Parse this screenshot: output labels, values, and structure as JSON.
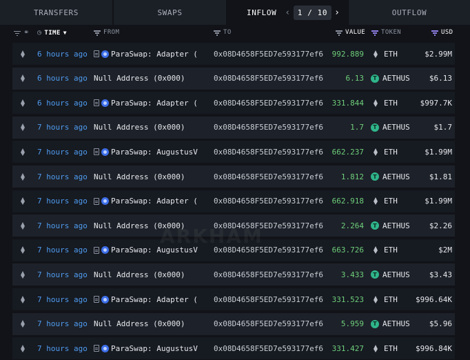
{
  "tabs": [
    {
      "label": "TRANSFERS"
    },
    {
      "label": "SWAPS"
    },
    {
      "label": "INFLOW",
      "active": true,
      "page": "1 / 10"
    },
    {
      "label": "OUTFLOW"
    }
  ],
  "columns": {
    "time": "TIME",
    "from": "FROM",
    "to": "TO",
    "value": "VALUE",
    "token": "TOKEN",
    "usd": "USD"
  },
  "watermark": "ARKHAM",
  "colors": {
    "link_blue": "#4f9cf0",
    "value_green": "#6fcf7b",
    "accent_purple": "#8f7fe6",
    "aethus_green": "#2fb58a"
  },
  "rows": [
    {
      "chain_icon": "ethereum-icon",
      "time": "6 hours ago",
      "from": "ParaSwap: Adapter (",
      "from_icons": true,
      "to": "0x08D4658F5ED7e593177ef6",
      "value": "992.889",
      "token": "ETH",
      "token_icon": "ethereum-icon",
      "usd": "$2.99M"
    },
    {
      "chain_icon": "ethereum-icon",
      "time": "6 hours ago",
      "from": "Null Address (0x000)",
      "from_icons": false,
      "to": "0x08D4658F5ED7e593177ef6",
      "value": "6.13",
      "token": "AETHUS",
      "token_icon": "aethus-icon",
      "usd": "$6.13"
    },
    {
      "chain_icon": "ethereum-icon",
      "time": "6 hours ago",
      "from": "ParaSwap: Adapter (",
      "from_icons": true,
      "to": "0x08D4658F5ED7e593177ef6",
      "value": "331.844",
      "token": "ETH",
      "token_icon": "ethereum-icon",
      "usd": "$997.7K"
    },
    {
      "chain_icon": "ethereum-icon",
      "time": "7 hours ago",
      "from": "Null Address (0x000)",
      "from_icons": false,
      "to": "0x08D4658F5ED7e593177ef6",
      "value": "1.7",
      "token": "AETHUS",
      "token_icon": "aethus-icon",
      "usd": "$1.7"
    },
    {
      "chain_icon": "ethereum-icon",
      "time": "7 hours ago",
      "from": "ParaSwap: AugustusV",
      "from_icons": true,
      "to": "0x08D4658F5ED7e593177ef6",
      "value": "662.237",
      "token": "ETH",
      "token_icon": "ethereum-icon",
      "usd": "$1.99M"
    },
    {
      "chain_icon": "ethereum-icon",
      "time": "7 hours ago",
      "from": "Null Address (0x000)",
      "from_icons": false,
      "to": "0x08D4658F5ED7e593177ef6",
      "value": "1.812",
      "token": "AETHUS",
      "token_icon": "aethus-icon",
      "usd": "$1.81"
    },
    {
      "chain_icon": "ethereum-icon",
      "time": "7 hours ago",
      "from": "ParaSwap: Adapter (",
      "from_icons": true,
      "to": "0x08D4658F5ED7e593177ef6",
      "value": "662.918",
      "token": "ETH",
      "token_icon": "ethereum-icon",
      "usd": "$1.99M"
    },
    {
      "chain_icon": "ethereum-icon",
      "time": "7 hours ago",
      "from": "Null Address (0x000)",
      "from_icons": false,
      "to": "0x08D4658F5ED7e593177ef6",
      "value": "2.264",
      "token": "AETHUS",
      "token_icon": "aethus-icon",
      "usd": "$2.26"
    },
    {
      "chain_icon": "ethereum-icon",
      "time": "7 hours ago",
      "from": "ParaSwap: AugustusV",
      "from_icons": true,
      "to": "0x08D4658F5ED7e593177ef6",
      "value": "663.726",
      "token": "ETH",
      "token_icon": "ethereum-icon",
      "usd": "$2M"
    },
    {
      "chain_icon": "ethereum-icon",
      "time": "7 hours ago",
      "from": "Null Address (0x000)",
      "from_icons": false,
      "to": "0x08D4658F5ED7e593177ef6",
      "value": "3.433",
      "token": "AETHUS",
      "token_icon": "aethus-icon",
      "usd": "$3.43"
    },
    {
      "chain_icon": "ethereum-icon",
      "time": "7 hours ago",
      "from": "ParaSwap: Adapter (",
      "from_icons": true,
      "to": "0x08D4658F5ED7e593177ef6",
      "value": "331.523",
      "token": "ETH",
      "token_icon": "ethereum-icon",
      "usd": "$996.64K"
    },
    {
      "chain_icon": "ethereum-icon",
      "time": "7 hours ago",
      "from": "Null Address (0x000)",
      "from_icons": false,
      "to": "0x08D4658F5ED7e593177ef6",
      "value": "5.959",
      "token": "AETHUS",
      "token_icon": "aethus-icon",
      "usd": "$5.96"
    },
    {
      "chain_icon": "ethereum-icon",
      "time": "7 hours ago",
      "from": "ParaSwap: AugustusV",
      "from_icons": true,
      "to": "0x08D4658F5ED7e593177ef6",
      "value": "331.427",
      "token": "ETH",
      "token_icon": "ethereum-icon",
      "usd": "$996.84K"
    }
  ]
}
